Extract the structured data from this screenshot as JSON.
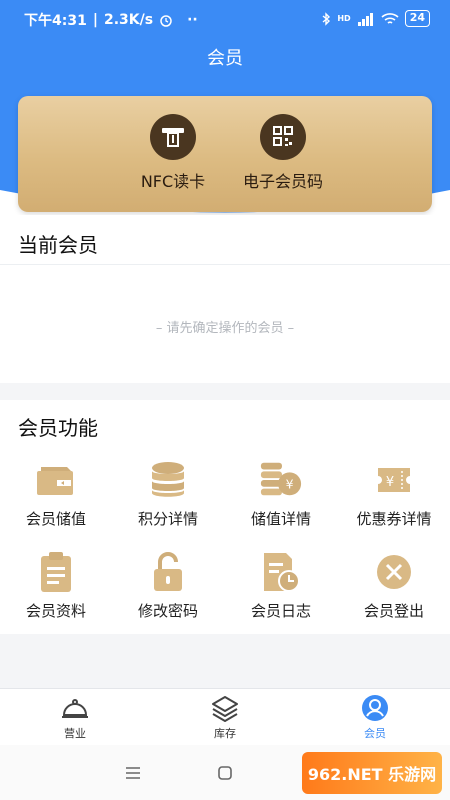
{
  "status": {
    "time": "下午4:31",
    "speed": "2.3K/s",
    "dots": "··",
    "hd": "HD",
    "battery": "24"
  },
  "header": {
    "title": "会员"
  },
  "card": {
    "nfc_label": "NFC读卡",
    "code_label": "电子会员码"
  },
  "current_member": {
    "title": "当前会员",
    "placeholder": "– 请先确定操作的会员 –"
  },
  "functions": {
    "title": "会员功能",
    "items": [
      {
        "label": "会员储值",
        "icon": "wallet-icon"
      },
      {
        "label": "积分详情",
        "icon": "coin-stack-icon"
      },
      {
        "label": "储值详情",
        "icon": "yen-coins-icon"
      },
      {
        "label": "优惠券详情",
        "icon": "ticket-icon"
      },
      {
        "label": "会员资料",
        "icon": "clipboard-icon"
      },
      {
        "label": "修改密码",
        "icon": "lock-icon"
      },
      {
        "label": "会员日志",
        "icon": "log-clock-icon"
      },
      {
        "label": "会员登出",
        "icon": "close-circle-icon"
      }
    ]
  },
  "nav": {
    "items": [
      {
        "label": "营业",
        "icon": "cloche-icon"
      },
      {
        "label": "库存",
        "icon": "layers-icon"
      },
      {
        "label": "会员",
        "icon": "user-icon"
      }
    ]
  },
  "watermark": {
    "text": "962.NET 乐游网"
  },
  "colors": {
    "primary": "#3b8bf5",
    "gold": "#d7b57c",
    "dark_brown": "#4a3620",
    "icon_gold": "#cfae7a"
  }
}
